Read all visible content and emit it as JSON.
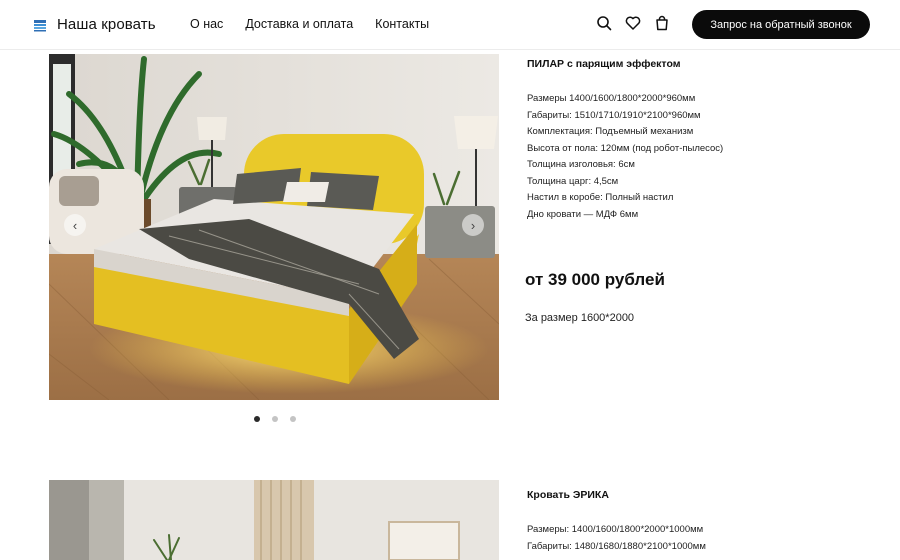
{
  "header": {
    "brand": "Наша кровать",
    "nav": [
      "О нас",
      "Доставка и оплата",
      "Контакты"
    ],
    "icons": [
      "search-icon",
      "heart-icon",
      "bag-icon"
    ],
    "cta_label": "Запрос на обратный звонок"
  },
  "products": [
    {
      "title": "ПИЛАР с парящим эффектом",
      "specs": [
        "Размеры 1400/1600/1800*2000*960мм",
        "Габариты: 1510/1710/1910*2100*960мм",
        "Комплектация: Подъемный механизм",
        "Высота от пола: 120мм (под робот-пылесос)",
        "Толщина изголовья: 6см",
        "Толщина царг: 4,5см",
        "Настил в коробе: Полный настил",
        "Дно кровати — МДФ 6мм"
      ],
      "price": "от 39 000 рублей",
      "price_note": "За размер 1600*2000",
      "slides_total": 3,
      "slide_active": 1
    },
    {
      "title": "Кровать ЭРИКА",
      "specs": [
        "Размеры: 1400/1600/1800*2000*1000мм",
        "Габариты: 1480/1680/1880*2100*1000мм"
      ]
    }
  ],
  "colors": {
    "accent": "#0b0b0b",
    "bed": "#e9c92a",
    "floor": "#b98a5c"
  }
}
